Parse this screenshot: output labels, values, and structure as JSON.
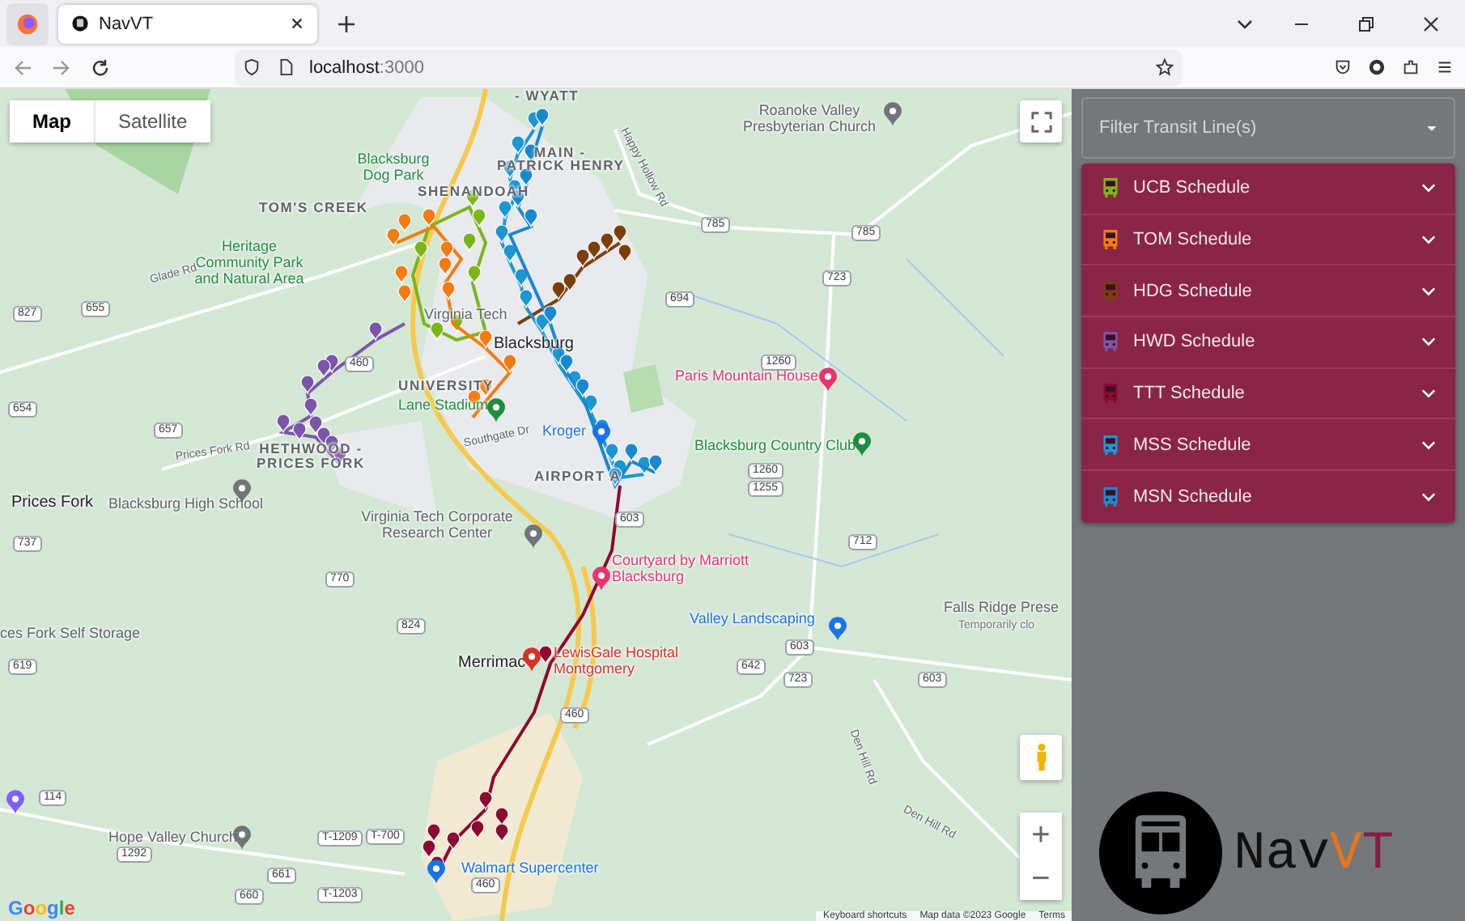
{
  "browser": {
    "tabs": [
      {
        "title": "NavVT",
        "selected": true
      }
    ],
    "address": {
      "host": "localhost",
      "port": ":3000"
    }
  },
  "map": {
    "map_type": [
      {
        "label": "Map",
        "selected": true
      },
      {
        "label": "Satellite",
        "selected": false
      }
    ],
    "labels": [
      {
        "text": "- WYATT",
        "kind": "district"
      },
      {
        "text": "MAIN -",
        "kind": "district"
      },
      {
        "text": "PATRICK HENRY",
        "kind": "district"
      },
      {
        "text": "Happy Hollow Rd",
        "kind": "road"
      },
      {
        "text": "Roanoke Valley Presbyterian Church",
        "kind": "place"
      },
      {
        "text": "Blacksburg Dog Park",
        "kind": "park"
      },
      {
        "text": "SHENANDOAH",
        "kind": "district"
      },
      {
        "text": "TOM'S CREEK",
        "kind": "district"
      },
      {
        "text": "Heritage Community Park and Natural Area",
        "kind": "park"
      },
      {
        "text": "Glade Rd",
        "kind": "road"
      },
      {
        "text": "Virginia Tech",
        "kind": "place"
      },
      {
        "text": "Blacksburg",
        "kind": "town"
      },
      {
        "text": "UNIVERSITY",
        "kind": "district"
      },
      {
        "text": "Lane Stadium",
        "kind": "park"
      },
      {
        "text": "Paris Mountain House",
        "kind": "lodging"
      },
      {
        "text": "Kroger",
        "kind": "shopping"
      },
      {
        "text": "Prices Fork Rd",
        "kind": "road"
      },
      {
        "text": "HETHWOOD - PRICES FORK",
        "kind": "district"
      },
      {
        "text": "Southgate Dr",
        "kind": "road"
      },
      {
        "text": "Blacksburg Country Club",
        "kind": "park"
      },
      {
        "text": "AIRPORT A",
        "kind": "district"
      },
      {
        "text": "Prices Fork",
        "kind": "town"
      },
      {
        "text": "Blacksburg High School",
        "kind": "place"
      },
      {
        "text": "Virginia Tech Corporate Research Center",
        "kind": "place"
      },
      {
        "text": "Courtyard by Marriott Blacksburg",
        "kind": "lodging"
      },
      {
        "text": "Valley Landscaping",
        "kind": "shopping"
      },
      {
        "text": "Falls Ridge Prese",
        "kind": "place"
      },
      {
        "text": "Temporarily clo",
        "kind": "note"
      },
      {
        "text": "ces Fork Self Storage",
        "kind": "place"
      },
      {
        "text": "Merrimac",
        "kind": "town"
      },
      {
        "text": "LewisGale Hospital Montgomery",
        "kind": "medical"
      },
      {
        "text": "Den Hill Rd",
        "kind": "road"
      },
      {
        "text": "Den Hill Rd",
        "kind": "road"
      },
      {
        "text": "Hope Valley Church",
        "kind": "place"
      },
      {
        "text": "Walmart Supercenter",
        "kind": "shopping"
      },
      {
        "text": "785",
        "kind": "shield"
      },
      {
        "text": "785",
        "kind": "shield"
      },
      {
        "text": "723",
        "kind": "shield"
      },
      {
        "text": "694",
        "kind": "shield"
      },
      {
        "text": "1260",
        "kind": "shield"
      },
      {
        "text": "1260",
        "kind": "shield"
      },
      {
        "text": "1255",
        "kind": "shield"
      },
      {
        "text": "655",
        "kind": "shield"
      },
      {
        "text": "827",
        "kind": "shield"
      },
      {
        "text": "654",
        "kind": "shield"
      },
      {
        "text": "657",
        "kind": "shield"
      },
      {
        "text": "460",
        "kind": "shield"
      },
      {
        "text": "603",
        "kind": "shield"
      },
      {
        "text": "737",
        "kind": "shield"
      },
      {
        "text": "770",
        "kind": "shield"
      },
      {
        "text": "824",
        "kind": "shield"
      },
      {
        "text": "603",
        "kind": "shield"
      },
      {
        "text": "642",
        "kind": "shield"
      },
      {
        "text": "723",
        "kind": "shield"
      },
      {
        "text": "603",
        "kind": "shield"
      },
      {
        "text": "619",
        "kind": "shield"
      },
      {
        "text": "460",
        "kind": "shield"
      },
      {
        "text": "114",
        "kind": "shield"
      },
      {
        "text": "1292",
        "kind": "shield"
      },
      {
        "text": "T-1209",
        "kind": "shield"
      },
      {
        "text": "T-700",
        "kind": "shield"
      },
      {
        "text": "T-1203",
        "kind": "shield"
      },
      {
        "text": "661",
        "kind": "shield"
      },
      {
        "text": "660",
        "kind": "shield"
      },
      {
        "text": "460",
        "kind": "shield"
      },
      {
        "text": "712",
        "kind": "shield"
      }
    ],
    "zoom_in": "+",
    "zoom_out": "−",
    "logo": "Google",
    "footer": [
      "Keyboard shortcuts",
      "Map data ©2023 Google",
      "Terms"
    ]
  },
  "sidebar": {
    "filter": {
      "placeholder": "Filter Transit Line(s)"
    },
    "schedules": [
      {
        "label": "UCB Schedule",
        "color": "#7cb518",
        "expanded": false
      },
      {
        "label": "TOM Schedule",
        "color": "#f27c13",
        "expanded": false
      },
      {
        "label": "HDG Schedule",
        "color": "#7b3f0e",
        "expanded": false
      },
      {
        "label": "HWD Schedule",
        "color": "#7b55a8",
        "expanded": false
      },
      {
        "label": "TTT Schedule",
        "color": "#8b0a30",
        "expanded": false
      },
      {
        "label": "MSS Schedule",
        "color": "#1d96d3",
        "expanded": false
      },
      {
        "label": "MSN Schedule",
        "color": "#1a88d0",
        "expanded": false
      }
    ],
    "logo": [
      {
        "text": "Nav",
        "color": "#111111"
      },
      {
        "text": "V",
        "color": "#e5751f"
      },
      {
        "text": "T",
        "color": "#861f41"
      }
    ]
  }
}
